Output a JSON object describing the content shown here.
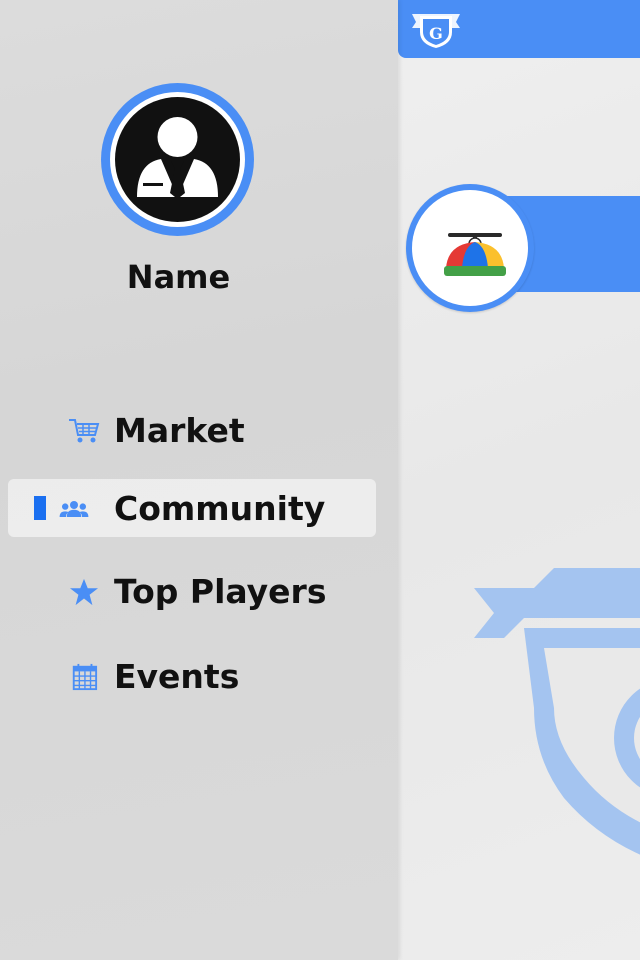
{
  "drawer": {
    "user_name": "Name",
    "nav": [
      {
        "label": "Market",
        "icon": "shopping-cart-icon",
        "active": false
      },
      {
        "label": "Community",
        "icon": "community-icon",
        "active": true
      },
      {
        "label": "Top Players",
        "icon": "star-icon",
        "active": false
      },
      {
        "label": "Events",
        "icon": "calendar-icon",
        "active": false
      }
    ]
  },
  "main": {
    "logo_letter": "G"
  },
  "colors": {
    "accent": "#4a8ef5",
    "indicator": "#1a6ff0",
    "text": "#111111"
  }
}
